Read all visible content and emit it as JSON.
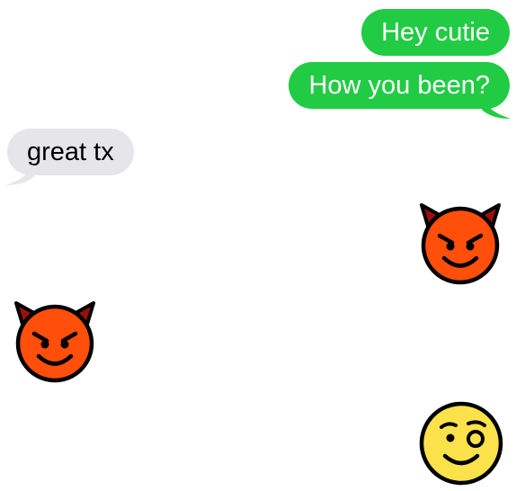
{
  "colors": {
    "sent": "#21CC44",
    "received": "#E6E5EA",
    "devil": "#FF4F0A",
    "wink": "#FCE24A"
  },
  "messages": [
    {
      "from": "me",
      "kind": "text",
      "text": "Hey cutie"
    },
    {
      "from": "me",
      "kind": "text",
      "text": "How you been?"
    },
    {
      "from": "them",
      "kind": "text",
      "text": "great tx"
    },
    {
      "from": "me",
      "kind": "emoji",
      "icon": "smiling-devil-emoji"
    },
    {
      "from": "them",
      "kind": "emoji",
      "icon": "smiling-devil-emoji"
    },
    {
      "from": "me",
      "kind": "emoji",
      "icon": "winking-face-emoji"
    }
  ]
}
